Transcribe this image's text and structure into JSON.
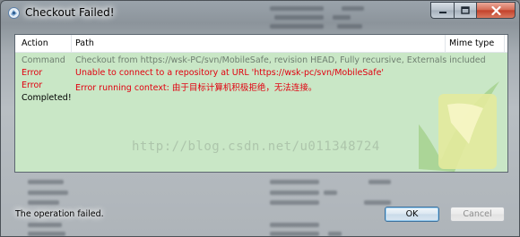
{
  "window": {
    "title": "Checkout Failed!"
  },
  "table": {
    "columns": [
      "Action",
      "Path",
      "Mime type"
    ],
    "rows": [
      {
        "action": "Command",
        "path": "Checkout from https://wsk-PC/svn/MobileSafe, revision HEAD, Fully recursive, Externals included",
        "mime": ""
      },
      {
        "action": "Error",
        "path": "Unable to connect to a repository at URL 'https://wsk-pc/svn/MobileSafe'",
        "mime": ""
      },
      {
        "action": "Error",
        "path": "Error running context: 由于目标计算机积极拒绝，无法连接。",
        "mime": ""
      },
      {
        "action": "Completed!",
        "path": "",
        "mime": ""
      }
    ]
  },
  "watermark": "http://blog.csdn.net/u011348724",
  "status": "The operation failed.",
  "buttons": {
    "ok": "OK",
    "cancel": "Cancel"
  },
  "colors": {
    "error": "#e2000f",
    "command": "#6f7f70",
    "list_bg": "#c9e7c6",
    "logo_green": "#9fcf86"
  },
  "icons": {
    "app": "tortoisesvn-icon",
    "minimize": "minimize-icon",
    "maximize": "maximize-icon",
    "close": "close-icon"
  }
}
